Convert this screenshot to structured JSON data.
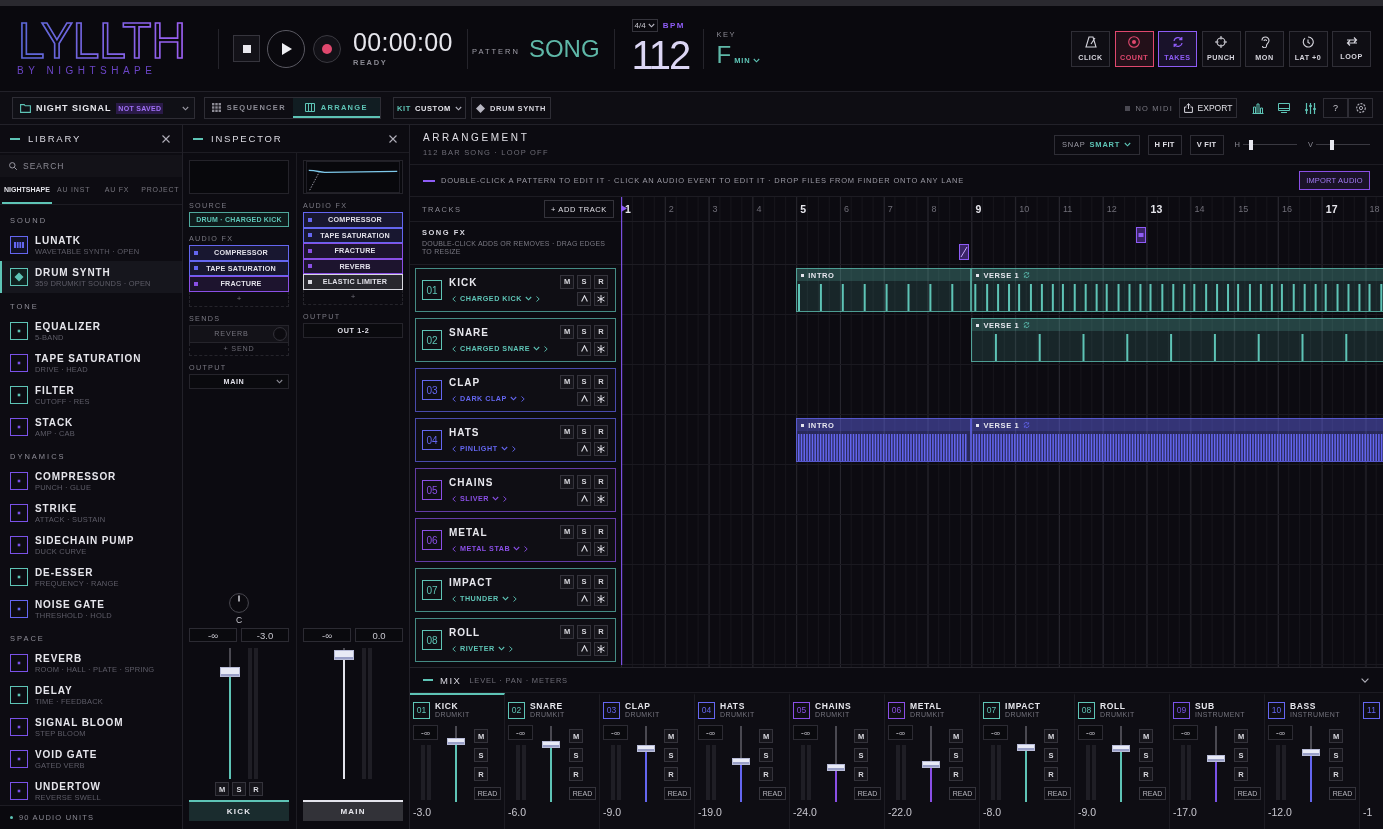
{
  "header": {
    "logo": "LYLLTH",
    "byline": "BY NIGHTSHAPE",
    "time": "00:00:00",
    "status": "READY",
    "modes": [
      {
        "label": "PATTERN",
        "selected": false
      },
      {
        "label": "SONG",
        "selected": true
      }
    ],
    "signature": "4/4",
    "bpm_label": "BPM",
    "bpm": "112",
    "key_label": "KEY",
    "key": "F",
    "scale": "MIN",
    "toggles": [
      {
        "label": "CLICK",
        "on": false
      },
      {
        "label": "COUNT",
        "on": true,
        "color": "#e0486e"
      },
      {
        "label": "TAKES",
        "on": true,
        "color": "#8e5cf6"
      },
      {
        "label": "PUNCH",
        "on": false
      },
      {
        "label": "MON",
        "on": false
      },
      {
        "label": "LAT +0",
        "on": false
      },
      {
        "label": "LOOP",
        "on": false
      }
    ]
  },
  "toolbar": {
    "project": "NIGHT SIGNAL",
    "project_status": "NOT SAVED",
    "views": [
      {
        "label": "SEQUENCER",
        "selected": false
      },
      {
        "label": "ARRANGE",
        "selected": true
      }
    ],
    "kit_label": "KIT",
    "kit": "CUSTOM",
    "instrument": "DRUM SYNTH",
    "midi": "NO MIDI",
    "export": "EXPORT",
    "help": "?"
  },
  "library": {
    "title": "LIBRARY",
    "search": {
      "placeholder": "SEARCH"
    },
    "tabs": [
      {
        "label": "NIGHTSHAPE",
        "selected": true
      },
      {
        "label": "AU INST",
        "selected": false
      },
      {
        "label": "AU FX",
        "selected": false
      },
      {
        "label": "PROJECT",
        "selected": false
      }
    ],
    "sections": [
      {
        "title": "SOUND",
        "items": [
          {
            "kind": "instrument",
            "name": "LUNATK",
            "detail": "WAVETABLE SYNTH · OPEN",
            "color": "#6466f0",
            "selected": false
          },
          {
            "kind": "drumkit",
            "name": "DRUM SYNTH",
            "detail": "359 DRUMKIT SOUNDS · OPEN",
            "color": "#5ec4b6",
            "selected": true
          }
        ]
      },
      {
        "title": "TONE",
        "items": [
          {
            "kind": "effect",
            "name": "EQUALIZER",
            "detail": "5-BAND",
            "color": "#5ec4b6",
            "selected": false
          },
          {
            "kind": "effect",
            "name": "TAPE SATURATION",
            "detail": "DRIVE · HEAD",
            "color": "#7a52e8",
            "selected": false
          },
          {
            "kind": "effect",
            "name": "FILTER",
            "detail": "CUTOFF · RES",
            "color": "#5ec4b6",
            "selected": false
          },
          {
            "kind": "effect",
            "name": "STACK",
            "detail": "AMP · CAB",
            "color": "#7a52e8",
            "selected": false
          }
        ]
      },
      {
        "title": "DYNAMICS",
        "items": [
          {
            "kind": "effect",
            "name": "COMPRESSOR",
            "detail": "PUNCH · GLUE",
            "color": "#7a52e8",
            "selected": false
          },
          {
            "kind": "effect",
            "name": "STRIKE",
            "detail": "ATTACK · SUSTAIN",
            "color": "#7a52e8",
            "selected": false
          },
          {
            "kind": "effect",
            "name": "SIDECHAIN PUMP",
            "detail": "DUCK CURVE",
            "color": "#7a52e8",
            "selected": false
          },
          {
            "kind": "effect",
            "name": "DE-ESSER",
            "detail": "FREQUENCY · RANGE",
            "color": "#5ec4b6",
            "selected": false
          },
          {
            "kind": "effect",
            "name": "NOISE GATE",
            "detail": "THRESHOLD · HOLD",
            "color": "#6466f0",
            "selected": false
          }
        ]
      },
      {
        "title": "SPACE",
        "items": [
          {
            "kind": "effect",
            "name": "REVERB",
            "detail": "ROOM · HALL · PLATE · SPRING",
            "color": "#7a52e8",
            "selected": false
          },
          {
            "kind": "effect",
            "name": "DELAY",
            "detail": "TIME · FEEDBACK",
            "color": "#5ec4b6",
            "selected": false
          },
          {
            "kind": "effect",
            "name": "SIGNAL BLOOM",
            "detail": "STEP BLOOM",
            "color": "#7a52e8",
            "selected": false
          },
          {
            "kind": "effect",
            "name": "VOID GATE",
            "detail": "GATED VERB",
            "color": "#7a52e8",
            "selected": false
          },
          {
            "kind": "effect",
            "name": "UNDERTOW",
            "detail": "REVERSE SWELL",
            "color": "#7a52e8",
            "selected": false
          }
        ]
      }
    ],
    "footer": "90 AUDIO UNITS"
  },
  "inspector": {
    "title": "INSPECTOR",
    "channel": {
      "source_label": "SOURCE",
      "source": "DRUM · CHARGED KICK",
      "fx_label": "AUDIO FX",
      "fx": [
        {
          "name": "COMPRESSOR",
          "color": "#6466f0"
        },
        {
          "name": "TAPE SATURATION",
          "color": "#6466f0"
        },
        {
          "name": "FRACTURE",
          "color": "#8a4fe6"
        }
      ],
      "add_fx": "+",
      "sends_label": "SENDS",
      "sends": [
        "REVERB"
      ],
      "add_send": "+ SEND",
      "output_label": "OUTPUT",
      "output": "MAIN",
      "pan": "C",
      "peak": "-∞",
      "gain": "-3.0",
      "level": 0.84,
      "buttons": [
        "M",
        "S",
        "R"
      ],
      "name": "KICK",
      "color": "#5ec4b6"
    },
    "master": {
      "fx_label": "AUDIO FX",
      "fx": [
        {
          "name": "COMPRESSOR",
          "color": "#6466f0"
        },
        {
          "name": "TAPE SATURATION",
          "color": "#6466f0"
        },
        {
          "name": "FRACTURE",
          "color": "#8a4fe6"
        },
        {
          "name": "REVERB",
          "color": "#8a4fe6"
        },
        {
          "name": "ELASTIC LIMITER",
          "color": "#d8d8e0"
        }
      ],
      "add_fx": "+",
      "output_label": "OUTPUT",
      "output": "OUT 1-2",
      "peak": "-∞",
      "gain": "0.0",
      "level": 0.98,
      "name": "MAIN",
      "color": "#e4e4ec"
    }
  },
  "arrangement": {
    "title": "ARRANGEMENT",
    "subtitle": "112 BAR SONG · LOOP OFF",
    "snap_label": "SNAP",
    "snap": "SMART",
    "fit_buttons": [
      "H FIT",
      "V FIT"
    ],
    "zoom": [
      {
        "label": "H",
        "level": 0.13
      },
      {
        "label": "V",
        "level": 0.27
      }
    ],
    "hint": "DOUBLE-CLICK A PATTERN TO EDIT IT · CLICK AN AUDIO EVENT TO EDIT IT · DROP FILES FROM FINDER ONTO ANY LANE",
    "import": "IMPORT AUDIO",
    "tracks_label": "TRACKS",
    "add_track": "+ ADD TRACK",
    "bars": [
      "1",
      "2",
      "3",
      "4",
      "5",
      "6",
      "7",
      "8",
      "9",
      "10",
      "11",
      "12",
      "13",
      "14",
      "15",
      "16",
      "17",
      "18"
    ],
    "song_fx": {
      "title": "SONG FX",
      "hint": "DOUBLE-CLICK ADDS OR REMOVES · DRAG EDGES TO RESIZE",
      "markers": [
        {
          "kind": "slash"
        },
        {
          "kind": "block"
        }
      ]
    },
    "tracks": [
      {
        "number": "01",
        "name": "KICK",
        "sound": "CHARGED KICK",
        "color": "#5ec4b6",
        "buttons": [
          "M",
          "S",
          "R"
        ],
        "clips": [
          {
            "label": "INTRO",
            "kind": "sparse",
            "looped": false
          },
          {
            "label": "VERSE 1",
            "kind": "steady",
            "looped": true
          }
        ]
      },
      {
        "number": "02",
        "name": "SNARE",
        "sound": "CHARGED SNARE",
        "color": "#5ec4b6",
        "buttons": [
          "M",
          "S",
          "R"
        ],
        "clips": [
          {
            "label": "VERSE 1",
            "kind": "backbeat",
            "looped": true
          }
        ]
      },
      {
        "number": "03",
        "name": "CLAP",
        "sound": "DARK CLAP",
        "color": "#6466f0",
        "buttons": [
          "M",
          "S",
          "R"
        ]
      },
      {
        "number": "04",
        "name": "HATS",
        "sound": "PINLIGHT",
        "color": "#6466f0",
        "buttons": [
          "M",
          "S",
          "R"
        ],
        "clips": [
          {
            "label": "INTRO",
            "kind": "dense",
            "looped": false
          },
          {
            "label": "VERSE 1",
            "kind": "dense",
            "looped": true
          }
        ]
      },
      {
        "number": "05",
        "name": "CHAINS",
        "sound": "SLIVER",
        "color": "#8a4fe6",
        "buttons": [
          "M",
          "S",
          "R"
        ]
      },
      {
        "number": "06",
        "name": "METAL",
        "sound": "METAL STAB",
        "color": "#8a4fe6",
        "buttons": [
          "M",
          "S",
          "R"
        ]
      },
      {
        "number": "07",
        "name": "IMPACT",
        "sound": "THUNDER",
        "color": "#5ec4b6",
        "buttons": [
          "M",
          "S",
          "R"
        ]
      },
      {
        "number": "08",
        "name": "ROLL",
        "sound": "RIVETER",
        "color": "#5ec4b6",
        "buttons": [
          "M",
          "S",
          "R"
        ]
      }
    ]
  },
  "mixer": {
    "title": "MIX",
    "subtitle": "LEVEL · PAN · METERS",
    "channels": [
      {
        "number": "01",
        "name": "KICK",
        "type": "DRUMKIT",
        "color": "#5ec4b6",
        "selected": true,
        "peak": "-∞",
        "level": 0.83,
        "buttons": [
          "M",
          "S",
          "R"
        ],
        "mode": "READ",
        "gain": "-3.0"
      },
      {
        "number": "02",
        "name": "SNARE",
        "type": "DRUMKIT",
        "color": "#5ec4b6",
        "selected": false,
        "peak": "-∞",
        "level": 0.78,
        "buttons": [
          "M",
          "S",
          "R"
        ],
        "mode": "READ",
        "gain": "-6.0"
      },
      {
        "number": "03",
        "name": "CLAP",
        "type": "DRUMKIT",
        "color": "#6466f0",
        "selected": false,
        "peak": "-∞",
        "level": 0.72,
        "buttons": [
          "M",
          "S",
          "R"
        ],
        "mode": "READ",
        "gain": "-9.0"
      },
      {
        "number": "04",
        "name": "HATS",
        "type": "DRUMKIT",
        "color": "#6466f0",
        "selected": false,
        "peak": "-∞",
        "level": 0.54,
        "buttons": [
          "M",
          "S",
          "R"
        ],
        "mode": "READ",
        "gain": "-19.0"
      },
      {
        "number": "05",
        "name": "CHAINS",
        "type": "DRUMKIT",
        "color": "#8a4fe6",
        "selected": false,
        "peak": "-∞",
        "level": 0.45,
        "buttons": [
          "M",
          "S",
          "R"
        ],
        "mode": "READ",
        "gain": "-24.0"
      },
      {
        "number": "06",
        "name": "METAL",
        "type": "DRUMKIT",
        "color": "#8a4fe6",
        "selected": false,
        "peak": "-∞",
        "level": 0.49,
        "buttons": [
          "M",
          "S",
          "R"
        ],
        "mode": "READ",
        "gain": "-22.0"
      },
      {
        "number": "07",
        "name": "IMPACT",
        "type": "DRUMKIT",
        "color": "#5ec4b6",
        "selected": false,
        "peak": "-∞",
        "level": 0.74,
        "buttons": [
          "M",
          "S",
          "R"
        ],
        "mode": "READ",
        "gain": "-8.0"
      },
      {
        "number": "08",
        "name": "ROLL",
        "type": "DRUMKIT",
        "color": "#5ec4b6",
        "selected": false,
        "peak": "-∞",
        "level": 0.72,
        "buttons": [
          "M",
          "S",
          "R"
        ],
        "mode": "READ",
        "gain": "-9.0"
      },
      {
        "number": "09",
        "name": "SUB",
        "type": "INSTRUMENT",
        "color": "#7a52e8",
        "selected": false,
        "peak": "-∞",
        "level": 0.58,
        "buttons": [
          "M",
          "S",
          "R"
        ],
        "mode": "READ",
        "gain": "-17.0"
      },
      {
        "number": "10",
        "name": "BASS",
        "type": "INSTRUMENT",
        "color": "#6466f0",
        "selected": false,
        "peak": "-∞",
        "level": 0.67,
        "buttons": [
          "M",
          "S",
          "R"
        ],
        "mode": "READ",
        "gain": "-12.0"
      },
      {
        "number": "11",
        "color": "#6466f0",
        "selected": false,
        "gain": "-1"
      }
    ]
  }
}
